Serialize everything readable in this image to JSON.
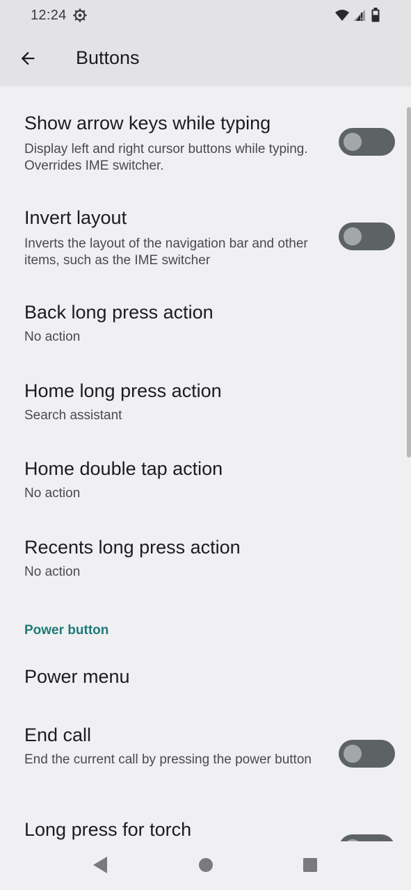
{
  "status_bar": {
    "time": "12:24"
  },
  "app_bar": {
    "title": "Buttons"
  },
  "preferences": [
    {
      "title": "Show arrow keys while typing",
      "summary": "Display left and right cursor buttons while typing. Overrides IME switcher.",
      "toggle": false
    },
    {
      "title": "Invert layout",
      "summary": "Inverts the layout of the navigation bar and other items, such as the IME switcher",
      "toggle": false
    },
    {
      "title": "Back long press action",
      "summary": "No action"
    },
    {
      "title": "Home long press action",
      "summary": "Search assistant"
    },
    {
      "title": "Home double tap action",
      "summary": "No action"
    },
    {
      "title": "Recents long press action",
      "summary": "No action"
    }
  ],
  "power_section": {
    "header": "Power button",
    "items": [
      {
        "title": "Power menu"
      },
      {
        "title": "End call",
        "summary": "End the current call by pressing the power button",
        "toggle": false
      },
      {
        "title": "Long press for torch",
        "toggle": false
      }
    ]
  },
  "colors": {
    "accent": "#1f7a78",
    "switch_track_off": "#5d6265",
    "switch_thumb_off": "#a3a7aa",
    "background": "#f0f0f2",
    "app_bar": "#e3e3e5"
  },
  "icons": {
    "back": "arrow-back-icon",
    "status": [
      "settings-gear-icon",
      "wifi-icon",
      "cell-signal-icon",
      "battery-icon"
    ],
    "nav": [
      "nav-back-icon",
      "nav-home-icon",
      "nav-recents-icon"
    ]
  }
}
